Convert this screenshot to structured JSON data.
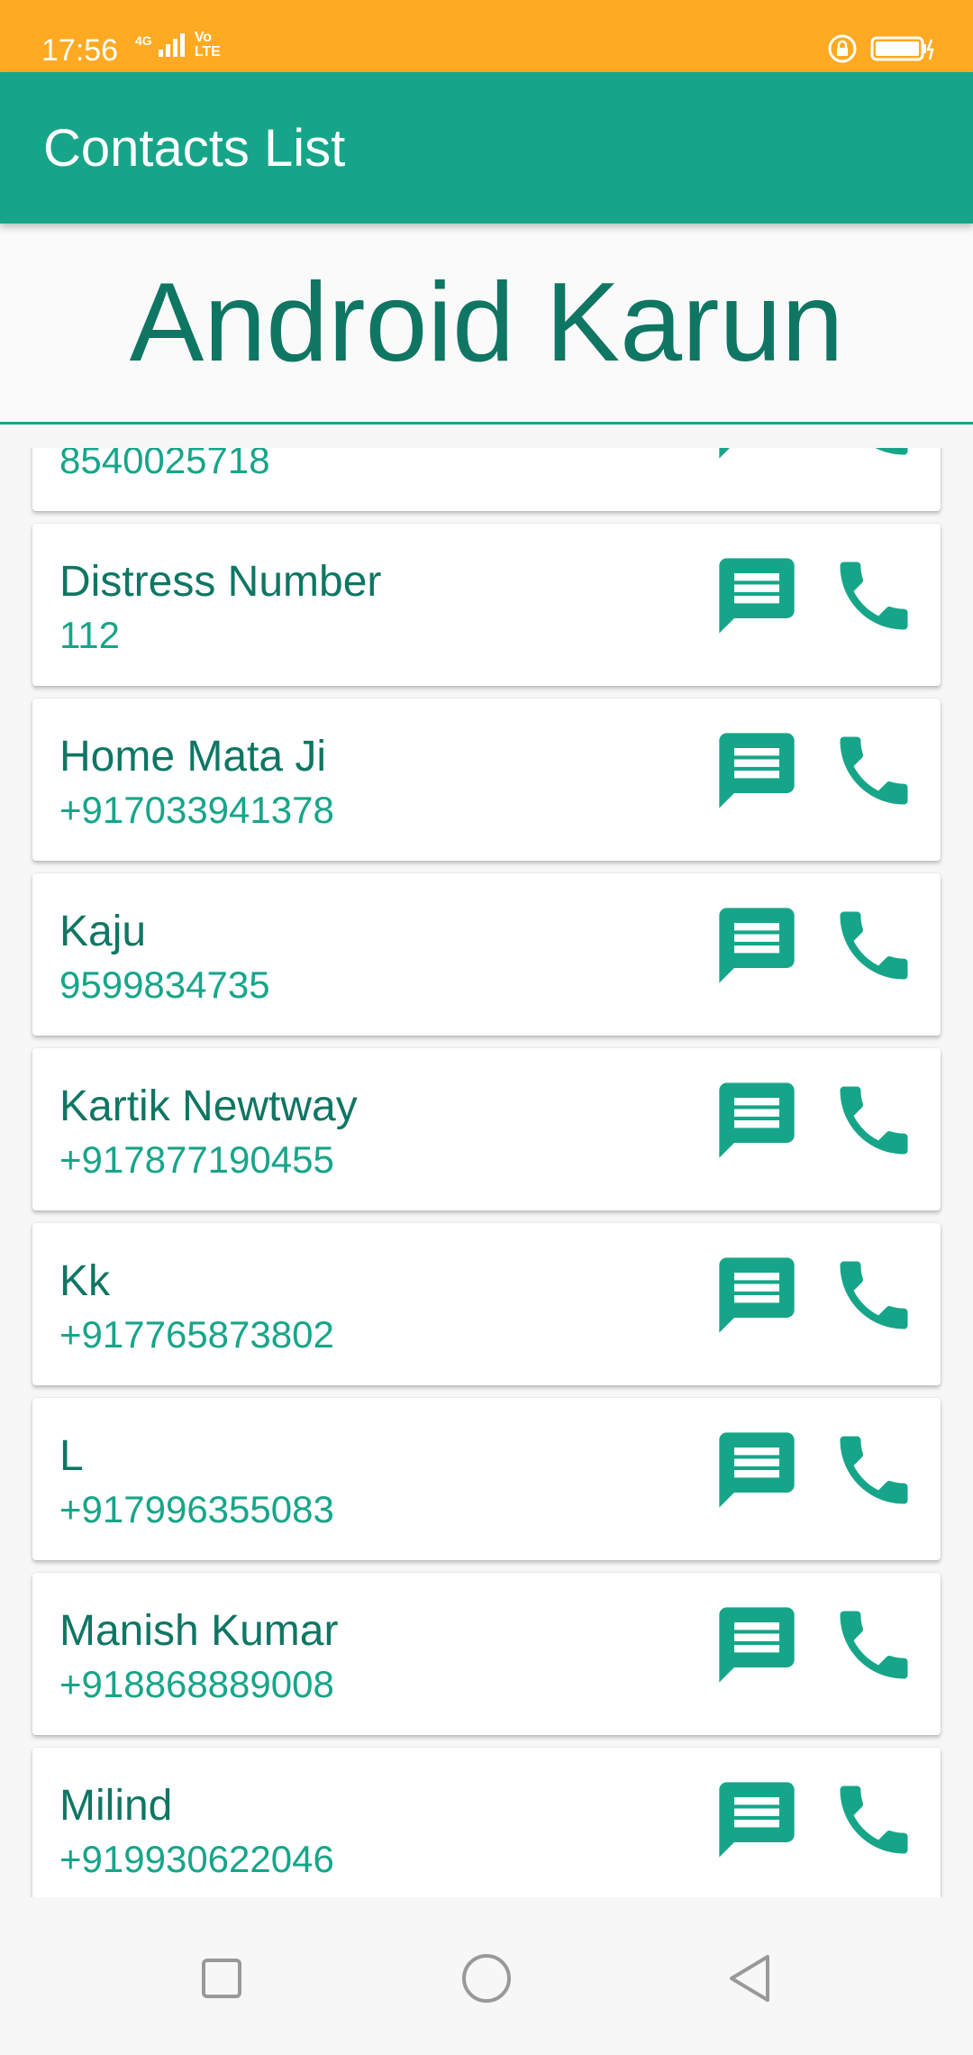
{
  "status_bar": {
    "time": "17:56",
    "network_label": "4G",
    "volte_label": "Vo LTE",
    "color": "#FFAA22"
  },
  "app_bar": {
    "title": "Contacts List",
    "color": "#17A589"
  },
  "header": {
    "brand_text": "Android Karun"
  },
  "contacts": [
    {
      "name": "",
      "phone": "8540025718"
    },
    {
      "name": "Distress Number",
      "phone": "112"
    },
    {
      "name": "Home Mata Ji",
      "phone": "+917033941378"
    },
    {
      "name": "Kaju",
      "phone": "9599834735"
    },
    {
      "name": "Kartik Newtway",
      "phone": "+917877190455"
    },
    {
      "name": "Kk",
      "phone": "+917765873802"
    },
    {
      "name": "L",
      "phone": "+917996355083"
    },
    {
      "name": "Manish Kumar",
      "phone": "+918868889008"
    },
    {
      "name": "Milind",
      "phone": "+919930622046"
    }
  ],
  "icons": {
    "message": "message-icon",
    "call": "phone-icon"
  },
  "nav_bar": {
    "buttons": [
      "recents-icon",
      "home-icon",
      "back-icon"
    ]
  },
  "colors": {
    "accent": "#17A589",
    "text_dark": "#0f7663"
  }
}
